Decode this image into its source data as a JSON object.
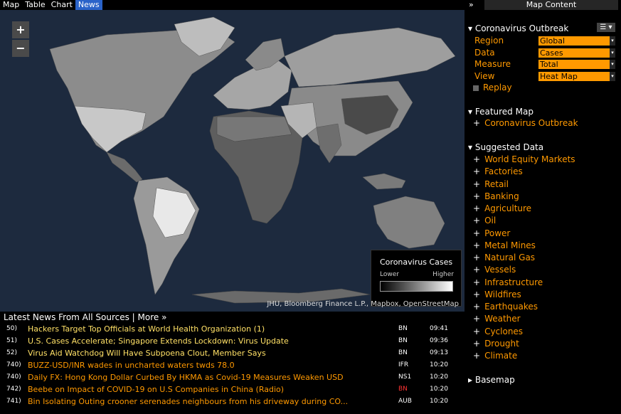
{
  "tabs": [
    "Map",
    "Table",
    "Chart",
    "News"
  ],
  "active_tab": "News",
  "map": {
    "zoom_in": "+",
    "zoom_out": "−",
    "legend": {
      "title": "Coronavirus Cases",
      "low": "Lower",
      "high": "Higher"
    },
    "attribution": "JHU, Bloomberg Finance L.P., Mapbox, OpenStreetMap"
  },
  "news": {
    "header": "Latest News From All Sources | More »",
    "rows": [
      {
        "num": "50)",
        "headline": "Hackers Target Top Officials at World Health Organization (1)",
        "source": "BN",
        "time": "09:41",
        "color": "#ffe066",
        "source_color": "#ffffff"
      },
      {
        "num": "51)",
        "headline": "U.S. Cases Accelerate; Singapore Extends Lockdown: Virus Update",
        "source": "BN",
        "time": "09:36",
        "color": "#ffe066",
        "source_color": "#ffffff"
      },
      {
        "num": "52)",
        "headline": "Virus Aid Watchdog Will Have Subpoena Clout, Member Says",
        "source": "BN",
        "time": "09:13",
        "color": "#ffe066",
        "source_color": "#ffffff"
      },
      {
        "num": "740)",
        "headline": "BUZZ-USD/INR wades in uncharted waters twds 78.0",
        "source": "IFR",
        "time": "10:20",
        "color": "#ff9900",
        "source_color": "#ffffff"
      },
      {
        "num": "740)",
        "headline": "Daily FX: Hong Kong Dollar Curbed By HKMA as Covid-19 Measures Weaken USD",
        "source": "NS1",
        "time": "10:20",
        "color": "#ff9900",
        "source_color": "#ffffff"
      },
      {
        "num": "742)",
        "headline": "Beebe on Impact of COVID-19 on U.S Companies in China (Radio)",
        "source": "BN",
        "time": "10:20",
        "color": "#ff9900",
        "source_color": "#ff3333"
      },
      {
        "num": "741)",
        "headline": "Bin Isolating Outing crooner serenades neighbours from his driveway during CO...",
        "source": "AUB",
        "time": "10:20",
        "color": "#ff9900",
        "source_color": "#ffffff"
      }
    ]
  },
  "sidebar": {
    "collapse": "»",
    "title": "Map Content",
    "outbreak": {
      "header": "▾ Coronavirus Outbreak",
      "menu": "☰ ▾",
      "fields": [
        {
          "label": "Region",
          "value": "Global"
        },
        {
          "label": "Data",
          "value": "Cases"
        },
        {
          "label": "Measure",
          "value": "Total"
        },
        {
          "label": "View",
          "value": "Heat Map"
        }
      ],
      "replay": "Replay"
    },
    "featured": {
      "header": "▾ Featured Map",
      "items": [
        "Coronavirus Outbreak"
      ]
    },
    "suggested": {
      "header": "▾ Suggested Data",
      "items": [
        "World Equity Markets",
        "Factories",
        "Retail",
        "Banking",
        "Agriculture",
        "Oil",
        "Power",
        "Metal Mines",
        "Natural Gas",
        "Vessels",
        "Infrastructure",
        "Wildfires",
        "Earthquakes",
        "Weather",
        "Cyclones",
        "Drought",
        "Climate"
      ]
    },
    "basemap": "▸ Basemap"
  },
  "colors": {
    "accent": "#ff9900",
    "tab_active": "#2a63c9",
    "ocean": "#1d2a3e",
    "land": "#8a8a8a"
  }
}
